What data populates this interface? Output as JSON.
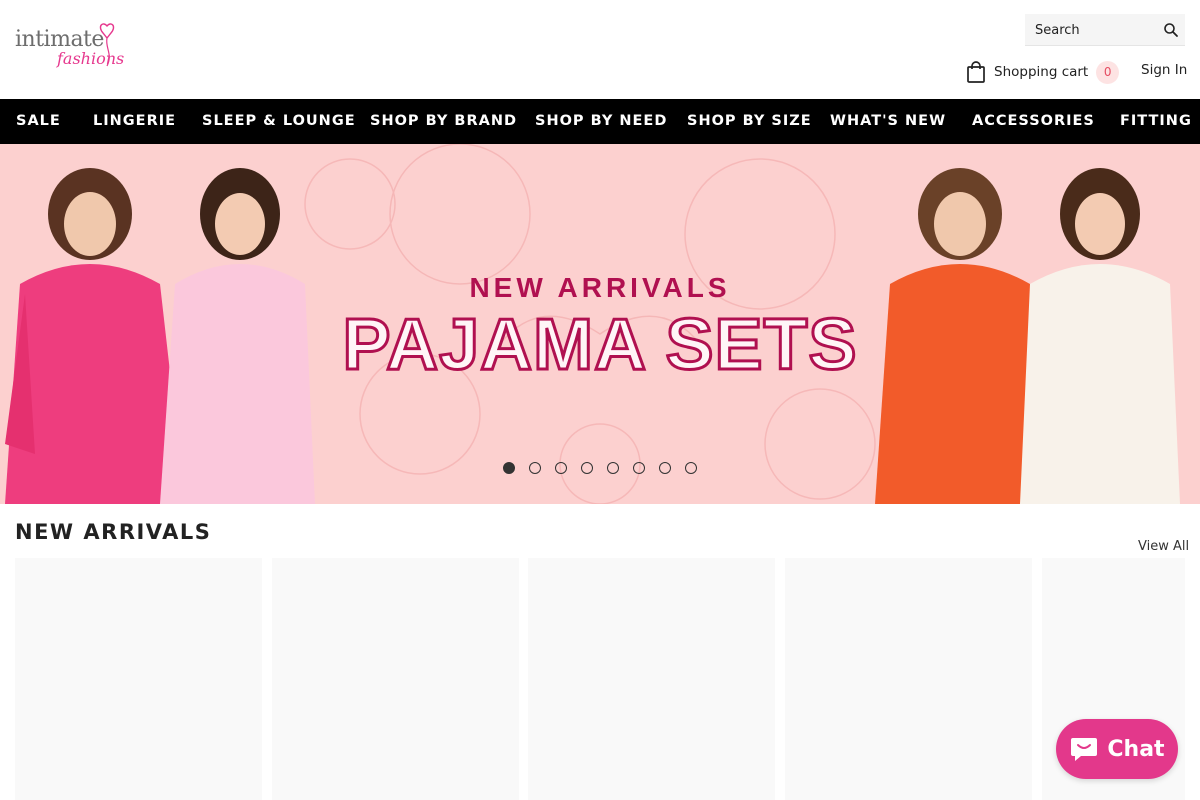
{
  "brand": {
    "logo_word": "intimate",
    "logo_script": "fashions",
    "logo_color": "#e6388e"
  },
  "search": {
    "placeholder": "Search",
    "icon": "search-icon"
  },
  "cart": {
    "label": "Shopping cart",
    "count": "0",
    "icon": "shopping-bag-icon"
  },
  "account": {
    "signin_label": "Sign In"
  },
  "nav": {
    "items": [
      {
        "label": "SALE"
      },
      {
        "label": "LINGERIE"
      },
      {
        "label": "SLEEP & LOUNGE"
      },
      {
        "label": "SHOP BY BRAND"
      },
      {
        "label": "SHOP BY NEED"
      },
      {
        "label": "SHOP BY SIZE"
      },
      {
        "label": "WHAT'S NEW"
      },
      {
        "label": "ACCESSORIES"
      },
      {
        "label": "FITTING"
      }
    ]
  },
  "hero": {
    "title_line1": "NEW ARRIVALS",
    "title_line2": "PAJAMA SETS",
    "accent_color": "#b01050",
    "background_color": "#fcd0cf",
    "slide_count": 8,
    "active_slide": 1
  },
  "new_arrivals": {
    "title": "NEW ARRIVALS",
    "view_all_label": "View All"
  },
  "chat": {
    "label": "Chat",
    "color": "#e3388b",
    "icon": "chat-bubble-icon"
  }
}
